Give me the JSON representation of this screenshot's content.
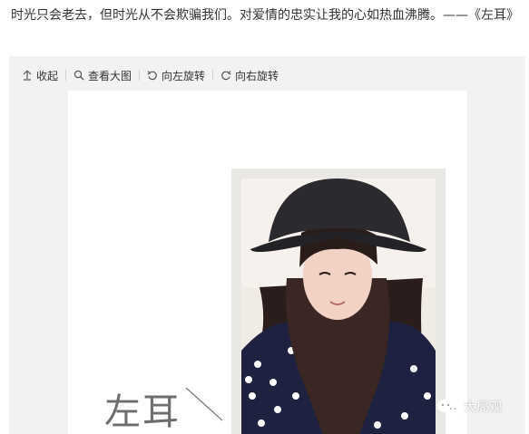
{
  "post": {
    "text": "时光只会老去，但时光从不会欺骗我们。对爱情的忠实让我的心如热血沸腾。——《左耳》"
  },
  "toolbar": {
    "collapse_label": "收起",
    "view_large_label": "查看大图",
    "rotate_left_label": "向左旋转",
    "rotate_right_label": "向右旋转"
  },
  "image": {
    "title_text": "左耳",
    "watermark_text": "大局观"
  }
}
